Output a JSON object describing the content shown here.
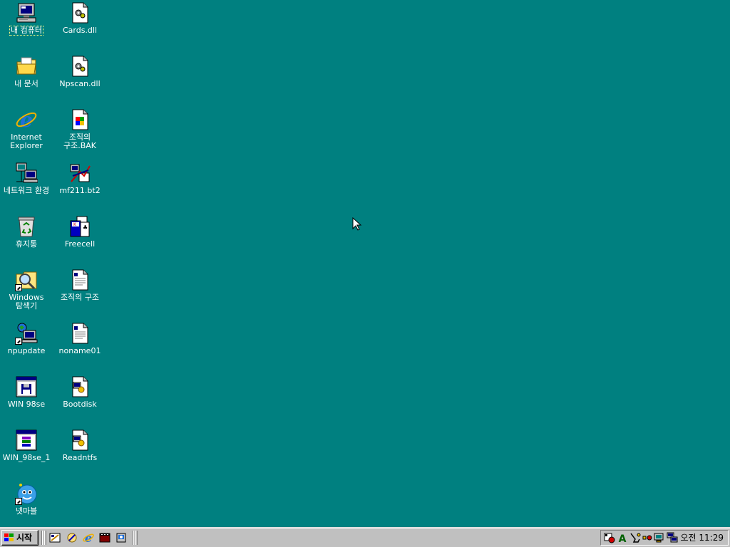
{
  "desktop": {
    "icons": [
      {
        "label": "내 컴퓨터",
        "icon": "my-computer-icon"
      },
      {
        "label": "Cards.dll",
        "icon": "dll-file-icon"
      },
      {
        "label": "내 문서",
        "icon": "my-documents-icon"
      },
      {
        "label": "Npscan.dll",
        "icon": "dll-file-icon"
      },
      {
        "label": "Internet Explorer",
        "icon": "internet-explorer-icon"
      },
      {
        "label": "조직의 구조.BAK",
        "icon": "backup-file-icon"
      },
      {
        "label": "네트워크 환경",
        "icon": "network-neighborhood-icon"
      },
      {
        "label": "mf211.bt2",
        "icon": "unknown-file-icon"
      },
      {
        "label": "휴지통",
        "icon": "recycle-bin-icon"
      },
      {
        "label": "Freecell",
        "icon": "freecell-icon"
      },
      {
        "label": "Windows 탐색기",
        "icon": "windows-explorer-icon"
      },
      {
        "label": "조직의 구조",
        "icon": "document-icon"
      },
      {
        "label": "npupdate",
        "icon": "network-update-icon"
      },
      {
        "label": "noname01",
        "icon": "document-icon"
      },
      {
        "label": "WIN 98se",
        "icon": "disk-image-icon"
      },
      {
        "label": "Bootdisk",
        "icon": "batch-file-icon"
      },
      {
        "label": "WIN_98se_1",
        "icon": "archive-icon"
      },
      {
        "label": "Readntfs",
        "icon": "batch-file-icon"
      },
      {
        "label": "넷마블",
        "icon": "netmarble-icon"
      }
    ]
  },
  "taskbar": {
    "start_label": "시작",
    "quick_launch": [
      "show-desktop-icon",
      "outlook-express-icon",
      "internet-explorer-icon",
      "media-player-icon",
      "channels-icon"
    ],
    "tray_icons": [
      "tray-app-icon",
      "font-icon",
      "tray-tool-icon",
      "volume-icon",
      "display-icon",
      "network-icon"
    ],
    "clock": "오전 11:29"
  },
  "colors": {
    "desktop": "#008080",
    "taskbar": "#c0c0c0"
  }
}
